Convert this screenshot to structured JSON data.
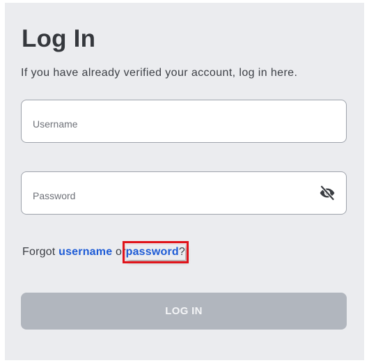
{
  "login": {
    "title": "Log In",
    "subtitle": "If you have already verified your account, log in here.",
    "username_placeholder": "Username",
    "password_placeholder": "Password",
    "toggle_password_icon": "eye-slash-icon",
    "forgot_prefix": "Forgot",
    "forgot_username_label": "username",
    "forgot_or": "or",
    "forgot_password_label": "password",
    "forgot_suffix": "?",
    "submit_label": "LOG IN",
    "colors": {
      "link": "#1d5bd6",
      "highlight": "#e0141b",
      "button_disabled": "#b1b6be",
      "panel_bg": "#ebecef"
    }
  }
}
